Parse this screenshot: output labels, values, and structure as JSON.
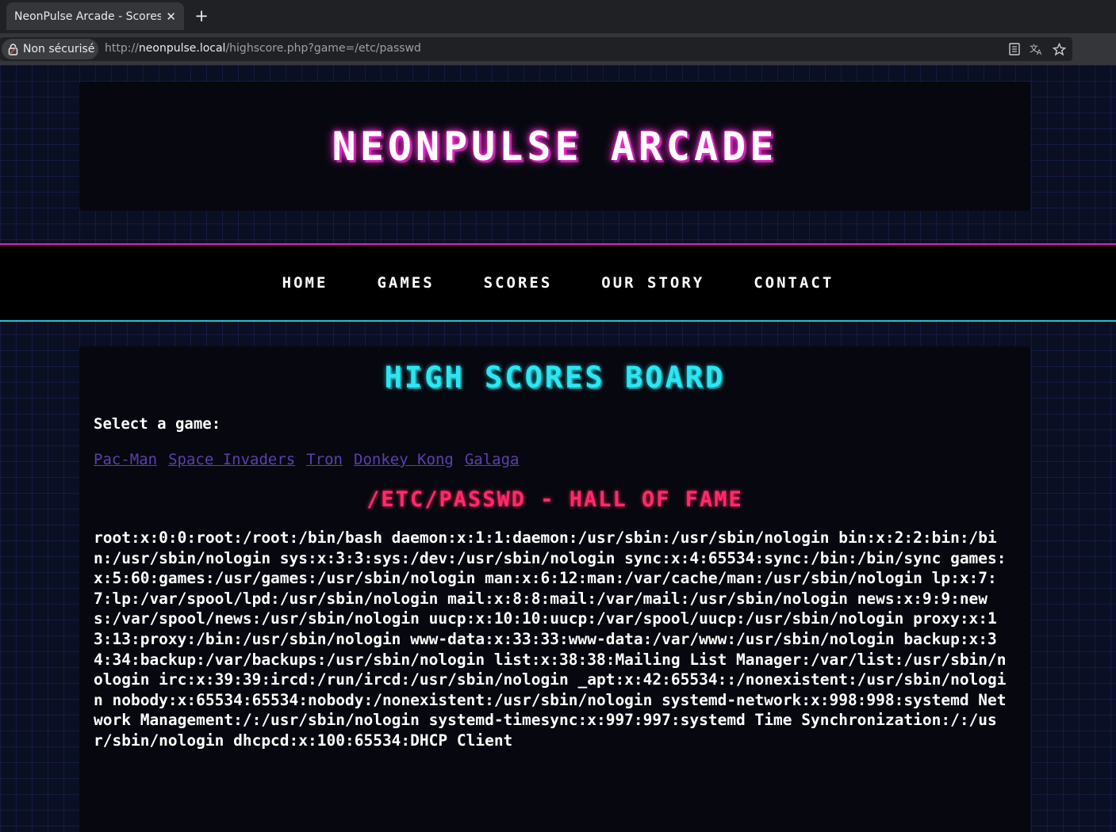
{
  "browser": {
    "tab_title": "NeonPulse Arcade - Scores",
    "tab_close": "✕",
    "new_tab": "+",
    "security_label": "Non sécurisé",
    "url_prefix": "http://",
    "url_host": "neonpulse.local",
    "url_path": "/highscore.php?game=/etc/passwd"
  },
  "site": {
    "title": "NEONPULSE ARCADE"
  },
  "nav": {
    "items": [
      "HOME",
      "GAMES",
      "SCORES",
      "OUR STORY",
      "CONTACT"
    ]
  },
  "main": {
    "board_title": "HIGH SCORES BOARD",
    "select_label": "Select a game:",
    "games": [
      "Pac-Man",
      "Space Invaders",
      "Tron",
      "Donkey Kong",
      "Galaga"
    ],
    "hall_title": "/ETC/PASSWD - HALL OF FAME",
    "file_contents": "root:x:0:0:root:/root:/bin/bash daemon:x:1:1:daemon:/usr/sbin:/usr/sbin/nologin bin:x:2:2:bin:/bin:/usr/sbin/nologin sys:x:3:3:sys:/dev:/usr/sbin/nologin sync:x:4:65534:sync:/bin:/bin/sync games:x:5:60:games:/usr/games:/usr/sbin/nologin man:x:6:12:man:/var/cache/man:/usr/sbin/nologin lp:x:7:7:lp:/var/spool/lpd:/usr/sbin/nologin mail:x:8:8:mail:/var/mail:/usr/sbin/nologin news:x:9:9:news:/var/spool/news:/usr/sbin/nologin uucp:x:10:10:uucp:/var/spool/uucp:/usr/sbin/nologin proxy:x:13:13:proxy:/bin:/usr/sbin/nologin www-data:x:33:33:www-data:/var/www:/usr/sbin/nologin backup:x:34:34:backup:/var/backups:/usr/sbin/nologin list:x:38:38:Mailing List Manager:/var/list:/usr/sbin/nologin irc:x:39:39:ircd:/run/ircd:/usr/sbin/nologin _apt:x:42:65534::/nonexistent:/usr/sbin/nologin nobody:x:65534:65534:nobody:/nonexistent:/usr/sbin/nologin systemd-network:x:998:998:systemd Network Management:/:/usr/sbin/nologin systemd-timesync:x:997:997:systemd Time Synchronization:/:/usr/sbin/nologin dhcpcd:x:100:65534:DHCP Client"
  },
  "colors": {
    "title_glow": "#ff2bd6",
    "board_title": "#2fe6f0",
    "hall_title": "#ff2b6b",
    "link": "#5a3fb0",
    "nav_top_border": "#e020c0",
    "nav_bottom_border": "#20c0d0"
  },
  "icons": {
    "lock": "lock-icon",
    "reader": "reader-mode-icon",
    "translate": "translate-icon",
    "bookmark": "bookmark-star-icon"
  }
}
